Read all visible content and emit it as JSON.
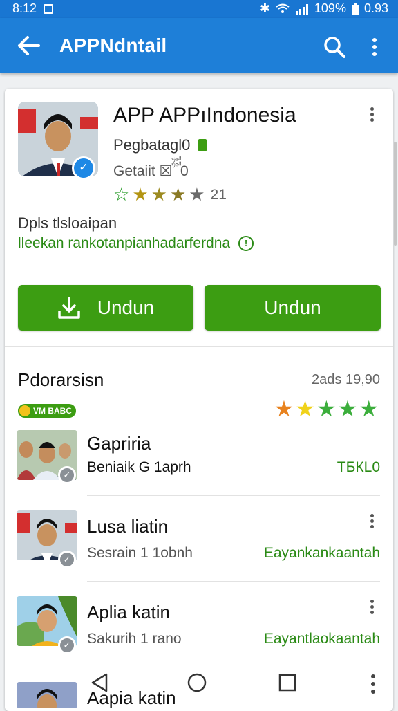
{
  "status": {
    "time": "8:12",
    "battery": "109%",
    "speed": "0.93"
  },
  "appbar": {
    "title": "APPNdntail"
  },
  "app": {
    "title": "APP APPıIndonesia",
    "developer": "Pegbatagl0",
    "meta": "Getaiit  ☒ ࢘࢘ 0",
    "rating_value": 3.5,
    "rating_count": "21",
    "desc1": "Dpls tlsloaipan",
    "desc2": "lleekan rankotanpianhadarferdna"
  },
  "buttons": {
    "install1": "Undun",
    "install2": "Undun"
  },
  "section": {
    "title": "Pdorarsisn",
    "right": "2ads 19,90",
    "badge": "VM BABC",
    "star_colors": [
      "#e8821e",
      "#f0d21a",
      "#3cae3c",
      "#3cae3c",
      "#3cae3c"
    ]
  },
  "items": [
    {
      "title": "Gapriria",
      "sub": "Beniaik G 1aprh",
      "right": "TБКL0"
    },
    {
      "title": "Lusa liatin",
      "sub": "Sesrain 1 1obnh",
      "right": "Eayankankaantah"
    },
    {
      "title": "Aplia katin",
      "sub": "Sakurih 1 rano",
      "right": "Eayantlaokaantah"
    },
    {
      "title": "Aapia katin",
      "sub": "",
      "right": ""
    }
  ],
  "colors": {
    "primary": "#1e7fd8",
    "install": "#3c9d12",
    "accent_text": "#2a8a15"
  }
}
